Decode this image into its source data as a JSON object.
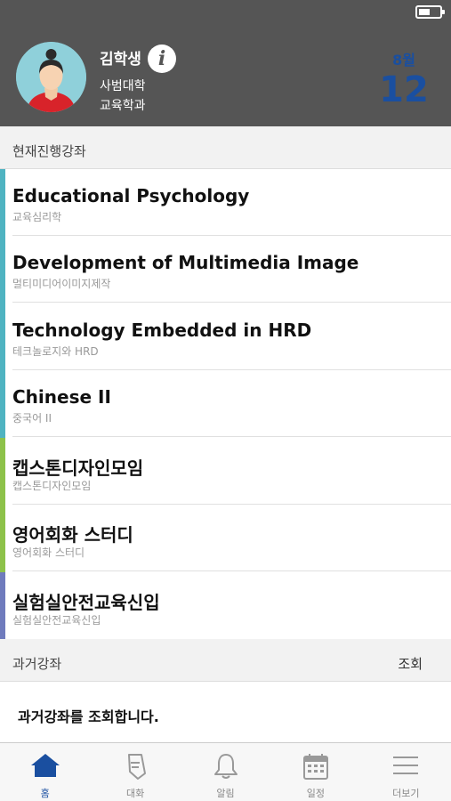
{
  "profile": {
    "name": "김학생",
    "college": "사범대학",
    "department": "교육학과",
    "date_month": "8월",
    "date_day": "12"
  },
  "current_section": {
    "title": "현재진행강좌"
  },
  "courses": [
    {
      "title": "Educational Psychology",
      "subtitle": "교육심리학",
      "color": "#4fb3c1"
    },
    {
      "title": "Development of Multimedia Image",
      "subtitle": "멀티미디어이미지제작",
      "color": "#4fb3c1"
    },
    {
      "title": "Technology Embedded in HRD",
      "subtitle": "테크놀로지와 HRD",
      "color": "#4fb3c1"
    },
    {
      "title": "Chinese II",
      "subtitle": "중국어 II",
      "color": "#4fb3c1"
    },
    {
      "title": "캡스톤디자인모임",
      "subtitle": "캡스톤디자인모임",
      "color": "#8dc24a"
    },
    {
      "title": "영어회화 스터디",
      "subtitle": "영어회화 스터디",
      "color": "#8dc24a"
    },
    {
      "title": "실험실안전교육신입",
      "subtitle": "실험실안전교육신입",
      "color": "#6f7bbd"
    }
  ],
  "past_section": {
    "title": "과거강좌",
    "action": "조회",
    "message": "과거강좌를 조회합니다."
  },
  "tabs": [
    {
      "label": "홈",
      "icon": "home-icon",
      "active": true
    },
    {
      "label": "대화",
      "icon": "chat-icon",
      "active": false
    },
    {
      "label": "알림",
      "icon": "bell-icon",
      "active": false
    },
    {
      "label": "일정",
      "icon": "calendar-icon",
      "active": false
    },
    {
      "label": "더보기",
      "icon": "menu-icon",
      "active": false
    }
  ],
  "colors": {
    "header_bg": "#555555",
    "accent": "#1a4fa0",
    "teal": "#4fb3c1",
    "green": "#8dc24a",
    "purple": "#6f7bbd"
  }
}
